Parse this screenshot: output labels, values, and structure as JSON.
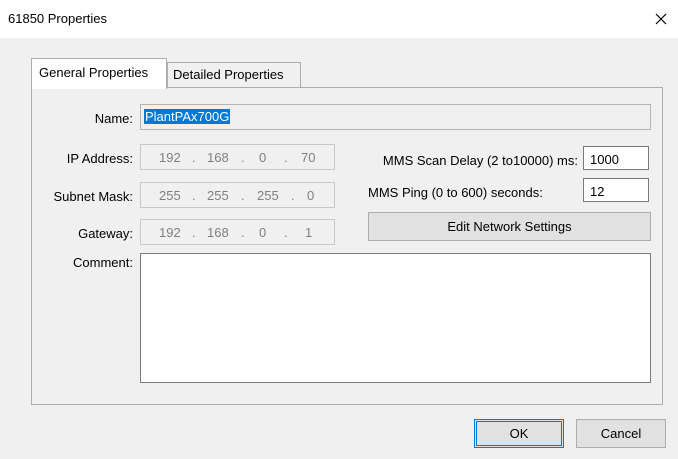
{
  "window": {
    "title": "61850 Properties",
    "close_glyph": "✕"
  },
  "tabs": [
    {
      "label": "General Properties",
      "active": true
    },
    {
      "label": "Detailed Properties",
      "active": false
    }
  ],
  "form": {
    "name_label": "Name:",
    "name_value": "PlantPAx700G",
    "ip_label": "IP Address:",
    "ip": [
      "192",
      "168",
      "0",
      "70"
    ],
    "subnet_label": "Subnet Mask:",
    "subnet": [
      "255",
      "255",
      "255",
      "0"
    ],
    "gateway_label": "Gateway:",
    "gateway": [
      "192",
      "168",
      "0",
      "1"
    ],
    "comment_label": "Comment:",
    "comment_value": "",
    "scan_delay_label": "MMS Scan Delay (2 to10000) ms:",
    "scan_delay_value": "1000",
    "ping_label": "MMS Ping (0 to 600) seconds:",
    "ping_value": "12",
    "edit_network_label": "Edit Network Settings"
  },
  "footer": {
    "ok_label": "OK",
    "cancel_label": "Cancel"
  }
}
